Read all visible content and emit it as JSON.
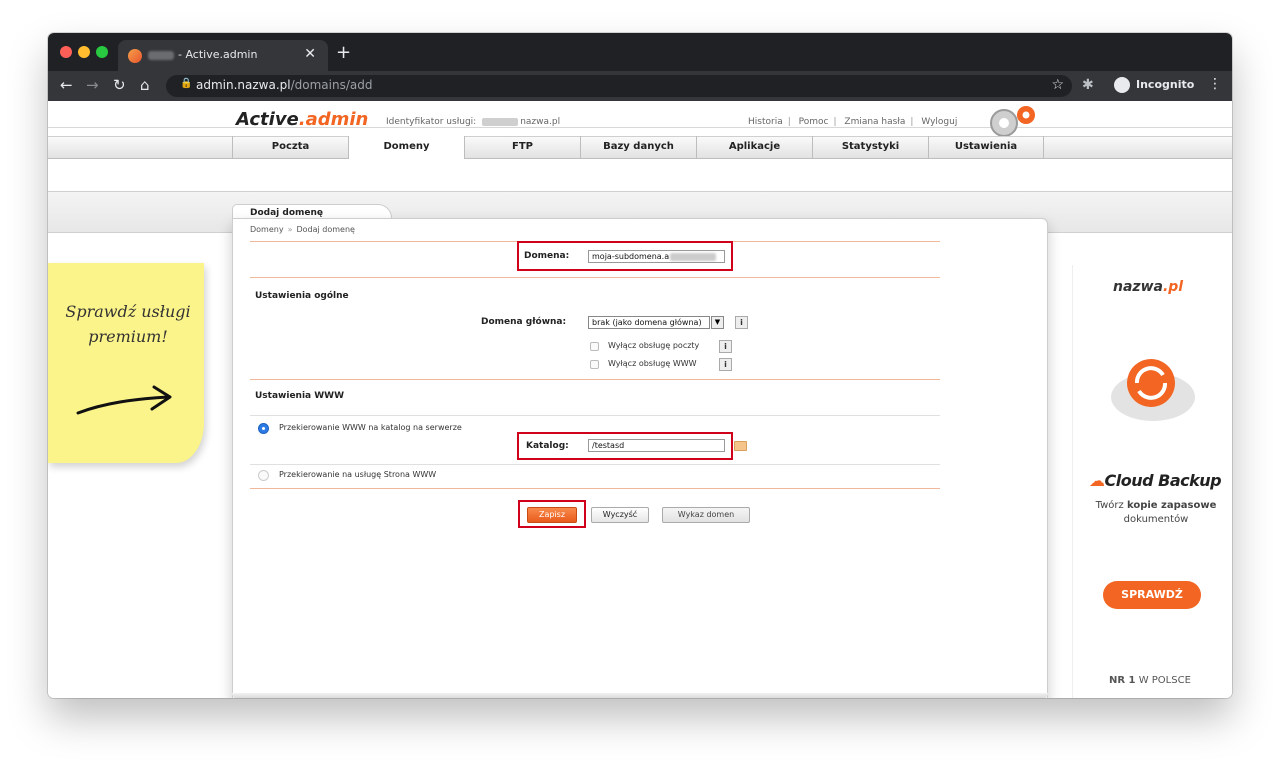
{
  "browser": {
    "tab_title": "- Active.admin",
    "url_host": "admin.nazwa.pl",
    "url_path": "/domains/add",
    "incognito_label": "Incognito"
  },
  "header": {
    "logo_main": "Active",
    "logo_accent": ".admin",
    "service_id_label": "Identyfikator usługi:",
    "service_id_value": "nazwa.pl",
    "links": [
      "Historia",
      "Pomoc",
      "Zmiana hasła",
      "Wyloguj"
    ]
  },
  "menu": {
    "items": [
      "Poczta",
      "Domeny",
      "FTP",
      "Bazy danych",
      "Aplikacje",
      "Statystyki",
      "Ustawienia"
    ],
    "active": "Domeny"
  },
  "panel": {
    "title": "Dodaj domenę",
    "breadcrumb": [
      "Domeny",
      "Dodaj domenę"
    ],
    "breadcrumb_sep": "»"
  },
  "form": {
    "domain_label": "Domena:",
    "domain_value": "moja-subdomena.a",
    "general_heading": "Ustawienia ogólne",
    "main_domain_label": "Domena główna:",
    "main_domain_value": "brak (jako domena główna)",
    "disable_mail_label": "Wyłącz obsługę poczty",
    "disable_www_label": "Wyłącz obsługę WWW",
    "www_heading": "Ustawienia WWW",
    "radio_dir_label": "Przekierowanie WWW na katalog na serwerze",
    "catalog_label": "Katalog:",
    "catalog_value": "/testasd",
    "radio_site_label": "Przekierowanie na usługę Strona WWW",
    "save_label": "Zapisz",
    "clear_label": "Wyczyść",
    "list_label": "Wykaz domen",
    "info_glyph": "i"
  },
  "sticky_note": {
    "text": "Sprawdź usługi premium!"
  },
  "ad": {
    "logo_main": "nazwa",
    "logo_accent": ".pl",
    "brand": "Cloud Backup",
    "desc_pre": "Twórz ",
    "desc_bold": "kopie zapasowe",
    "desc_post": " dokumentów",
    "button": "SPRAWDŹ",
    "nr_bold": "NR 1",
    "nr_rest": " W POLSCE"
  },
  "colors": {
    "accent": "#f26522",
    "highlight_box": "#d0021b",
    "radio_selected": "#2d7be5",
    "sticky": "#fbf48a"
  }
}
